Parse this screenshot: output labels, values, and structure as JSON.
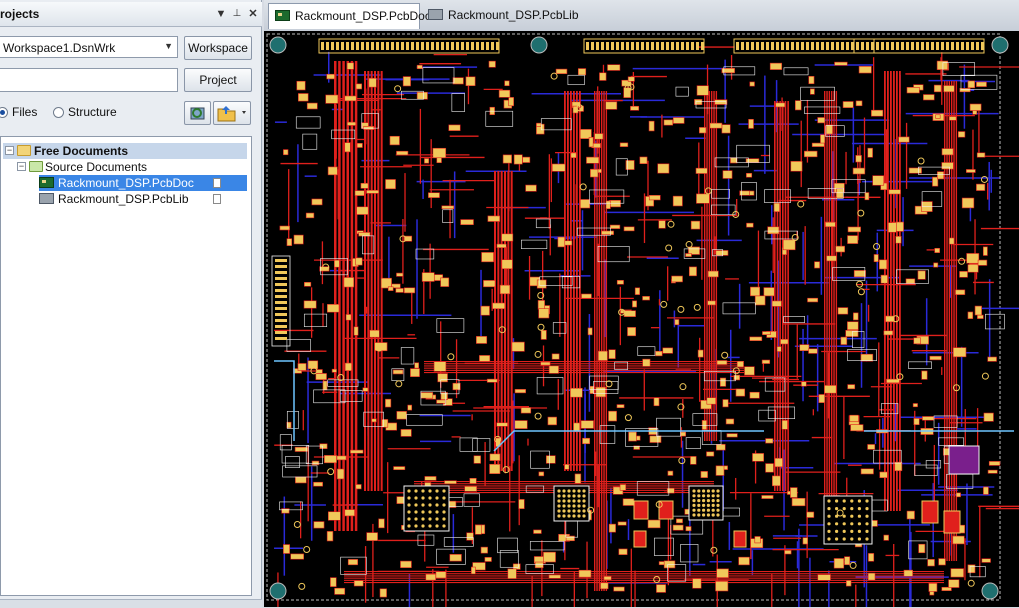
{
  "panel": {
    "title": "rojects",
    "title_buttons": [
      "▼",
      "📌",
      "✕"
    ],
    "workspace_combo": "Workspace1.DsnWrk",
    "workspace_button": "Workspace",
    "project_field": "",
    "project_button": "Project",
    "view_modes": [
      {
        "label": "Files",
        "selected": true
      },
      {
        "label": "Structure",
        "selected": false
      }
    ],
    "icon_buttons": [
      "refresh-project-icon",
      "open-folder-icon"
    ]
  },
  "tree": {
    "root": "Free Documents",
    "group": "Source Documents",
    "docs": [
      {
        "name": "Rackmount_DSP.PcbDoc",
        "selected": true,
        "icon": "pcb-document-icon"
      },
      {
        "name": "Rackmount_DSP.PcbLib",
        "selected": false,
        "icon": "pcb-library-icon"
      }
    ]
  },
  "tabs": [
    {
      "label": "Rackmount_DSP.PcbDoc",
      "active": true,
      "icon": "pcb-document-icon"
    },
    {
      "label": "Rackmount_DSP.PcbLib",
      "active": false,
      "icon": "pcb-library-icon"
    }
  ],
  "colors": {
    "board_bg": "#000000",
    "top_layer": "#e0201c",
    "bottom_layer": "#2a2ad8",
    "pads": "#f0c85a",
    "silkscreen": "#f2f2f2",
    "keepout": "#6ec6ff",
    "component": "#7a1f8c",
    "selection": "#3a78d8"
  }
}
